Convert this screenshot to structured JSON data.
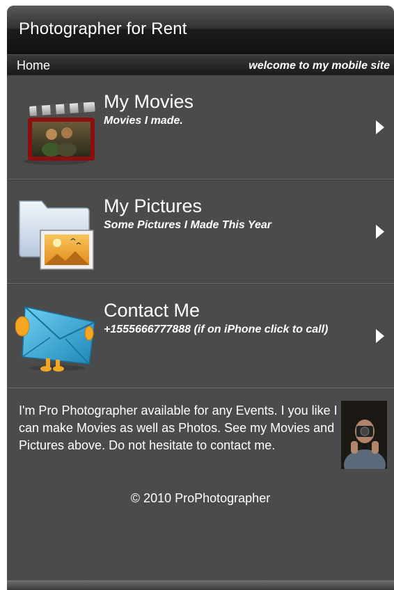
{
  "header": {
    "title": "Photographer for Rent"
  },
  "nav": {
    "home": "Home",
    "welcome": "welcome to my mobile site"
  },
  "items": [
    {
      "label": "My Movies",
      "sub": "Movies I made.",
      "icon": "movie-clapper-icon"
    },
    {
      "label": "My Pictures",
      "sub": "Some Pictures I Made This Year",
      "icon": "pictures-folder-icon"
    },
    {
      "label": "Contact Me",
      "sub": "+1555666777888 (if on iPhone click to call)",
      "icon": "envelope-icon"
    }
  ],
  "about": {
    "text": "I'm Pro Photographer available for any Events. I you like I can make Movies as well as Photos. See my Movies and Pictures above. Do not hesitate to contact me.",
    "copyright": "© 2010 ProPhotographer"
  },
  "colors": {
    "background": "#4b4b4b",
    "titlebar": "#1b1b1b",
    "text": "#ffffff"
  }
}
